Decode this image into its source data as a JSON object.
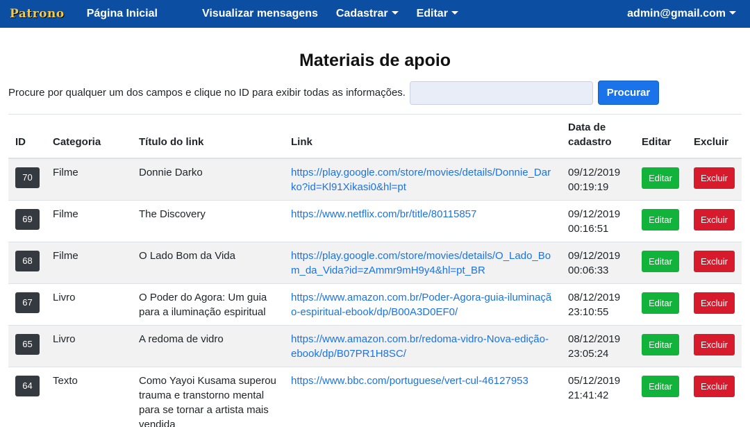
{
  "nav": {
    "brand": "Patrono",
    "home": "Página Inicial",
    "messages": "Visualizar mensagens",
    "register": "Cadastrar",
    "edit": "Editar",
    "user": "admin@gmail.com"
  },
  "page": {
    "title": "Materiais de apoio",
    "search_label": "Procure por qualquer um dos campos e clique no ID para exibir todas as informações.",
    "search_placeholder": "",
    "search_button": "Procurar"
  },
  "table": {
    "headers": {
      "id": "ID",
      "category": "Categoria",
      "title": "Título do link",
      "link": "Link",
      "date": "Data de cadastro",
      "edit": "Editar",
      "delete": "Excluir"
    },
    "rows": [
      {
        "id": "70",
        "category": "Filme",
        "title": "Donnie Darko",
        "link": "https://play.google.com/store/movies/details/Donnie_Darko?id=Kl91Xikasi0&hl=pt",
        "date": "09/12/2019 00:19:19",
        "edit": "Editar",
        "delete": "Excluir"
      },
      {
        "id": "69",
        "category": "Filme",
        "title": "The Discovery",
        "link": "https://www.netflix.com/br/title/80115857",
        "date": "09/12/2019 00:16:51",
        "edit": "Editar",
        "delete": "Excluir"
      },
      {
        "id": "68",
        "category": "Filme",
        "title": "O Lado Bom da Vida",
        "link": "https://play.google.com/store/movies/details/O_Lado_Bom_da_Vida?id=zAmmr9mH9y4&hl=pt_BR",
        "date": "09/12/2019 00:06:33",
        "edit": "Editar",
        "delete": "Excluir"
      },
      {
        "id": "67",
        "category": "Livro",
        "title": "O Poder do Agora: Um guia para a iluminação espiritual",
        "link": "https://www.amazon.com.br/Poder-Agora-guia-iluminação-espiritual-ebook/dp/B00A3D0EF0/",
        "date": "08/12/2019 23:10:55",
        "edit": "Editar",
        "delete": "Excluir"
      },
      {
        "id": "65",
        "category": "Livro",
        "title": "A redoma de vidro",
        "link": "https://www.amazon.com.br/redoma-vidro-Nova-edição-ebook/dp/B07PR1H8SC/",
        "date": "08/12/2019 23:05:24",
        "edit": "Editar",
        "delete": "Excluir"
      },
      {
        "id": "64",
        "category": "Texto",
        "title": "Como Yayoi Kusama superou trauma e transtorno mental para se tornar a artista mais vendida",
        "link": "https://www.bbc.com/portuguese/vert-cul-46127953",
        "date": "05/12/2019 21:41:42",
        "edit": "Editar",
        "delete": "Excluir"
      }
    ]
  },
  "colors": {
    "navbar": "#0b4ea2",
    "primary": "#1a73e8",
    "success": "#12b33a",
    "danger": "#d71a2c",
    "badge": "#343a40"
  }
}
